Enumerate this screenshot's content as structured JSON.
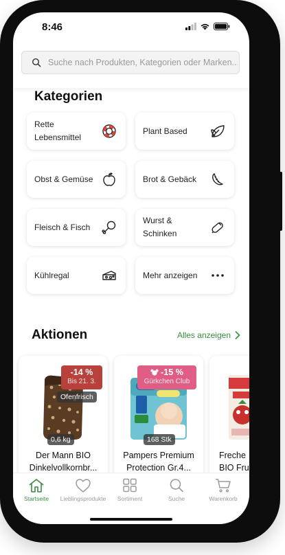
{
  "status": {
    "time": "8:46"
  },
  "search": {
    "placeholder": "Suche nach Produkten, Kategorien oder Marken..."
  },
  "categories": {
    "title": "Kategorien",
    "items": [
      {
        "label": "Rette Lebensmittel",
        "icon": "lifebuoy-icon"
      },
      {
        "label": "Plant Based",
        "icon": "leaf-icon"
      },
      {
        "label": "Obst & Gemüse",
        "icon": "apple-icon"
      },
      {
        "label": "Brot & Gebäck",
        "icon": "croissant-icon"
      },
      {
        "label": "Fleisch & Fisch",
        "icon": "drumstick-icon"
      },
      {
        "label": "Wurst & Schinken",
        "icon": "sausage-icon"
      },
      {
        "label": "Kühlregal",
        "icon": "cheese-icon"
      },
      {
        "label": "Mehr anzeigen",
        "icon": "more-dots-icon"
      }
    ]
  },
  "aktionen": {
    "title": "Aktionen",
    "link": "Alles anzeigen",
    "products": [
      {
        "badge_pct": "-14 %",
        "badge_sub": "Bis 21. 3.",
        "badge_color": "#b8423b",
        "tag": "Ofenfrisch",
        "qty": "0,6 kg",
        "name_line1": "Der Mann BIO",
        "name_line2": "Dinkelvollkornbr..."
      },
      {
        "badge_pct": "-15 %",
        "badge_sub": "Gürkchen Club",
        "badge_color": "#e05e84",
        "qty": "168 Stk",
        "name_line1": "Pampers Premium",
        "name_line2": "Protection Gr.4..."
      },
      {
        "name_line1": "Freche",
        "name_line2": "BIO Fru"
      }
    ]
  },
  "tabbar": {
    "items": [
      {
        "label": "Startseite",
        "icon": "home-icon",
        "active": true
      },
      {
        "label": "Lieblingsprodukte",
        "icon": "heart-icon"
      },
      {
        "label": "Sortiment",
        "icon": "grid-icon"
      },
      {
        "label": "Suche",
        "icon": "search-icon"
      },
      {
        "label": "Warenkorb",
        "icon": "cart-icon"
      }
    ]
  },
  "colors": {
    "accent": "#3a8a3f",
    "badge_red": "#b8423b",
    "badge_pink": "#e05e84"
  }
}
